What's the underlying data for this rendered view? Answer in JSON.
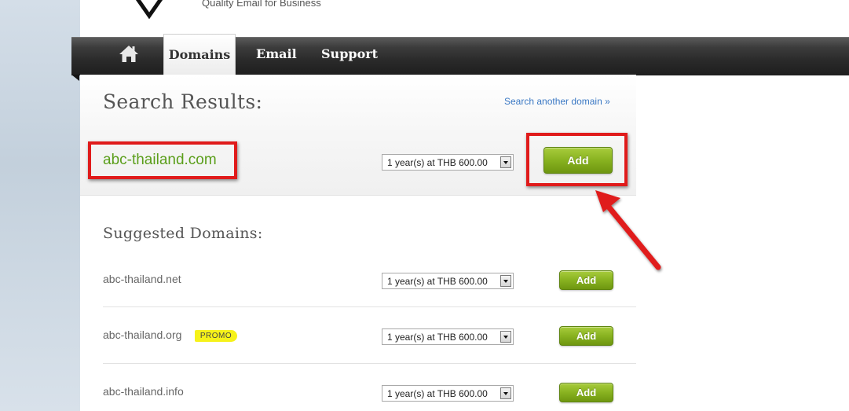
{
  "header": {
    "tagline": "Quality Email for Business"
  },
  "nav": {
    "items": [
      "Domains",
      "Email",
      "Support"
    ],
    "active": "Domains"
  },
  "search": {
    "title": "Search Results:",
    "another_link": "Search another domain »",
    "domain": "abc-thailand.com",
    "period": "1 year(s) at THB 600.00",
    "add_label": "Add"
  },
  "suggested": {
    "title": "Suggested Domains:",
    "rows": [
      {
        "domain": "abc-thailand.net",
        "period": "1 year(s) at THB 600.00",
        "add_label": "Add"
      },
      {
        "domain": "abc-thailand.org",
        "period": "1 year(s) at THB 600.00",
        "add_label": "Add",
        "badge": "PROMO"
      },
      {
        "domain": "abc-thailand.info",
        "period": "1 year(s) at THB 600.00",
        "add_label": "Add"
      }
    ]
  },
  "colors": {
    "domain_green": "#5a9e1a",
    "annotation_red": "#e01b1b",
    "link_blue": "#3a78c4",
    "button_green": "#88b220",
    "promo_yellow": "#f6f21a"
  },
  "icons": [
    "home-icon",
    "logo-shield",
    "dropdown-arrow-icon"
  ]
}
